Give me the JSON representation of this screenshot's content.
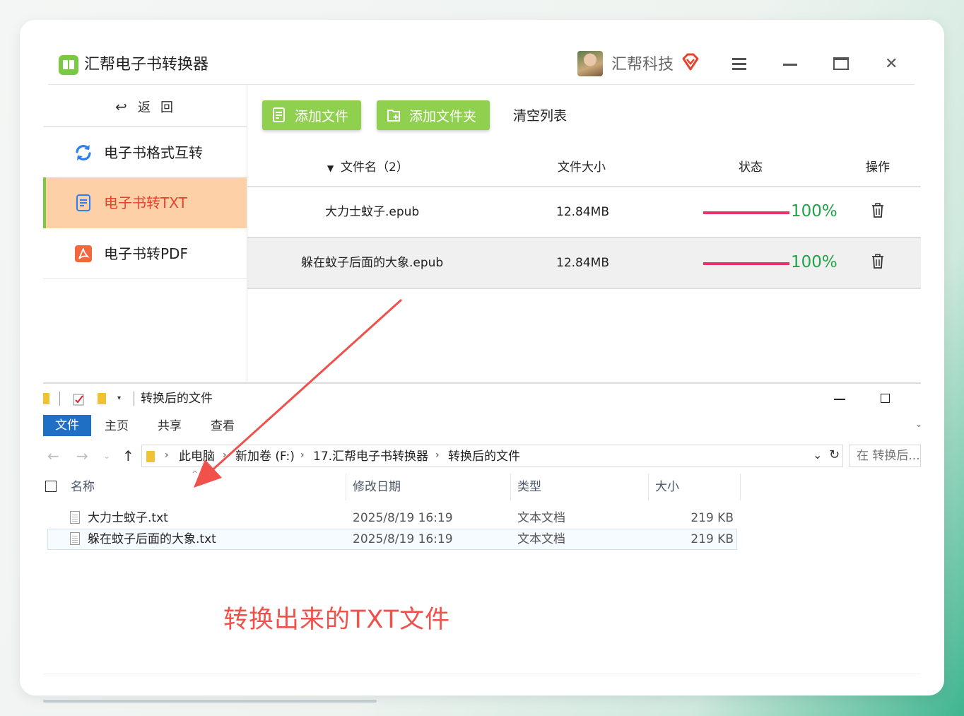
{
  "app": {
    "title": "汇帮电子书转换器",
    "user_name": "汇帮科技",
    "brand_color": "#7ac943"
  },
  "sidebar": {
    "back_label": "返回",
    "items": [
      {
        "label": "电子书格式互转",
        "icon": "refresh-icon",
        "active": false
      },
      {
        "label": "电子书转TXT",
        "icon": "document-icon",
        "active": true
      },
      {
        "label": "电子书转PDF",
        "icon": "pdf-icon",
        "active": false
      }
    ]
  },
  "toolbar": {
    "add_file": "添加文件",
    "add_folder": "添加文件夹",
    "clear_list": "清空列表"
  },
  "table": {
    "headers": {
      "name": "文件名（2）",
      "size": "文件大小",
      "status": "状态",
      "action": "操作"
    },
    "rows": [
      {
        "name": "大力士蚊子.epub",
        "size": "12.84MB",
        "progress": "100%",
        "progress_value": 1.0
      },
      {
        "name": "躲在蚊子后面的大象.epub",
        "size": "12.84MB",
        "progress": "100%",
        "progress_value": 1.0
      }
    ]
  },
  "explorer": {
    "window_title": "转换后的文件",
    "ribbon": {
      "file": "文件",
      "home": "主页",
      "share": "共享",
      "view": "查看"
    },
    "breadcrumb": [
      "此电脑",
      "新加卷 (F:)",
      "17.汇帮电子书转换器",
      "转换后的文件"
    ],
    "search_placeholder": "在 转换后...",
    "columns": {
      "name": "名称",
      "modified": "修改日期",
      "type": "类型",
      "size": "大小"
    },
    "files": [
      {
        "name": "大力士蚊子.txt",
        "modified": "2025/8/19 16:19",
        "type": "文本文档",
        "size": "219 KB"
      },
      {
        "name": "躲在蚊子后面的大象.txt",
        "modified": "2025/8/19 16:19",
        "type": "文本文档",
        "size": "219 KB"
      }
    ]
  },
  "annotation": {
    "text": "转换出来的TXT文件",
    "color": "#f0514b"
  }
}
